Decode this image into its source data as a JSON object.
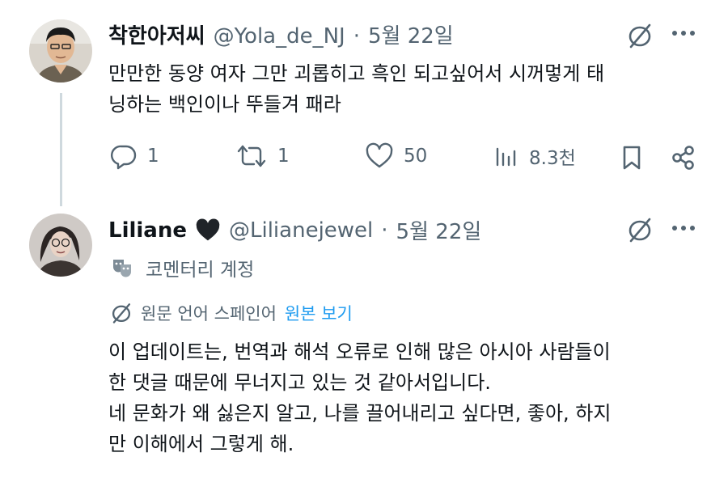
{
  "tweet1": {
    "display_name": "착한아저씨",
    "handle": "@Yola_de_NJ",
    "separator": "·",
    "date": "5월 22일",
    "text_line1": "만만한 동양 여자 그만 괴롭히고 흑인 되고싶어서 시꺼멓게 태",
    "text_line2": "닝하는 백인이나 뚜들겨 패라",
    "replies": "1",
    "reposts": "1",
    "likes": "50",
    "views": "8.3천",
    "icons": [
      "no-translate-icon",
      "more-icon",
      "reply-icon",
      "repost-icon",
      "like-icon",
      "views-icon",
      "bookmark-icon",
      "share-icon"
    ]
  },
  "tweet2": {
    "display_name": "Liliane",
    "handle": "@Lilianejewel",
    "separator": "·",
    "date": "5월 22일",
    "label": "코멘터리 계정",
    "translation_note": "원문 언어 스페인어",
    "show_original": "원본 보기",
    "text_line1": "이 업데이트는, 번역과 해석 오류로 인해 많은 아시아 사람들이",
    "text_line2": "한 댓글 때문에 무너지고 있는 것 같아서입니다.",
    "text_line3": "네 문화가 왜 싫은지 알고, 나를 끌어내리고 싶다면, 좋아, 하지",
    "text_line4": "만 이해에서 그렇게 해.",
    "icons": [
      "black-heart-icon",
      "theater-masks-icon",
      "no-translate-icon",
      "more-icon"
    ]
  },
  "colors": {
    "text": "#0f1419",
    "secondary": "#536471",
    "link": "#1d9bf0",
    "thread_line": "#cfd9de"
  }
}
